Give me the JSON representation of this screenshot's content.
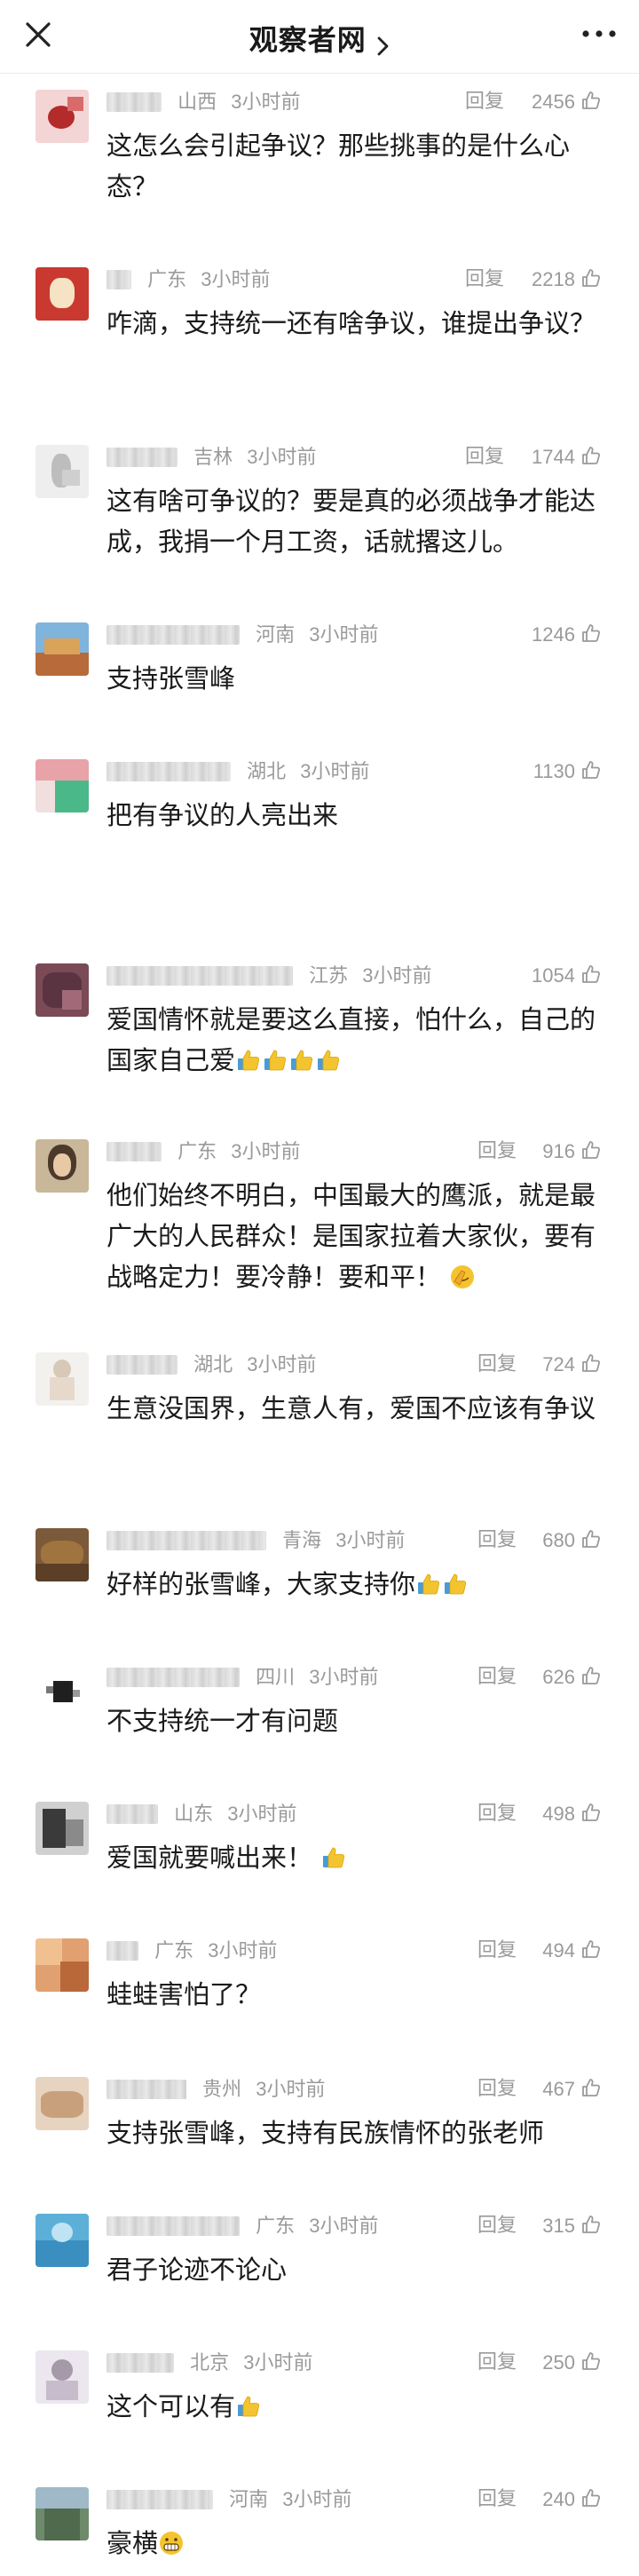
{
  "header": {
    "title": "观察者网"
  },
  "actions": {
    "reply_label": "回复"
  },
  "comments": [
    {
      "location": "山西",
      "time": "3小时前",
      "likes": "2456",
      "text": "这怎么会引起争议？那些挑事的是什么心态？"
    },
    {
      "location": "广东",
      "time": "3小时前",
      "likes": "2218",
      "text": "咋滴，支持统一还有啥争议，谁提出争议？"
    },
    {
      "location": "吉林",
      "time": "3小时前",
      "likes": "1744",
      "text": "这有啥可争议的？要是真的必须战争才能达成，我捐一个月工资，话就撂这儿。"
    },
    {
      "location": "河南",
      "time": "3小时前",
      "likes": "1246",
      "text": "支持张雪峰"
    },
    {
      "location": "湖北",
      "time": "3小时前",
      "likes": "1130",
      "text": "把有争议的人亮出来"
    },
    {
      "location": "江苏",
      "time": "3小时前",
      "likes": "1054",
      "text": "爱国情怀就是要这么直接，怕什么，自己的国家自己爱"
    },
    {
      "location": "广东",
      "time": "3小时前",
      "likes": "916",
      "text": "他们始终不明白，中国最大的鹰派，就是最广大的人民群众！是国家拉着大家伙，要有战略定力！要冷静！要和平！"
    },
    {
      "location": "湖北",
      "time": "3小时前",
      "likes": "724",
      "text": "生意没国界，生意人有，爱国不应该有争议"
    },
    {
      "location": "青海",
      "time": "3小时前",
      "likes": "680",
      "text": "好样的张雪峰，大家支持你"
    },
    {
      "location": "四川",
      "time": "3小时前",
      "likes": "626",
      "text": "不支持统一才有问题"
    },
    {
      "location": "山东",
      "time": "3小时前",
      "likes": "498",
      "text": "爱国就要喊出来！"
    },
    {
      "location": "广东",
      "time": "3小时前",
      "likes": "494",
      "text": "蛙蛙害怕了？"
    },
    {
      "location": "贵州",
      "time": "3小时前",
      "likes": "467",
      "text": "支持张雪峰，支持有民族情怀的张老师"
    },
    {
      "location": "广东",
      "time": "3小时前",
      "likes": "315",
      "text": "君子论迹不论心"
    },
    {
      "location": "北京",
      "time": "3小时前",
      "likes": "250",
      "text": "这个可以有"
    },
    {
      "location": "河南",
      "time": "3小时前",
      "likes": "240",
      "text": "豪横"
    }
  ],
  "colors": {
    "text": "#1a1a1a",
    "meta": "#9a9a9a",
    "thumbs_emoji": "#f4c430",
    "divider": "#ececec"
  },
  "icons": {
    "close": "close-icon",
    "chevron": "chevron-right-icon",
    "more": "more-icon",
    "like": "thumb-up-icon",
    "thumbs_emoji": "thumbs-up-emoji",
    "facepalm_emoji": "facepalm-emoji",
    "grin_emoji": "grin-emoji"
  }
}
